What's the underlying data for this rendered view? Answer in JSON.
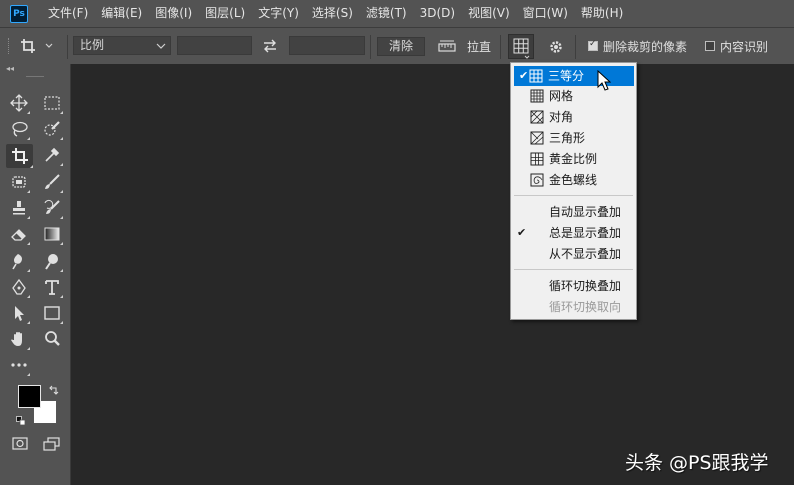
{
  "app": {
    "logo": "Ps"
  },
  "menu": [
    "文件(F)",
    "编辑(E)",
    "图像(I)",
    "图层(L)",
    "文字(Y)",
    "选择(S)",
    "滤镜(T)",
    "3D(D)",
    "视图(V)",
    "窗口(W)",
    "帮助(H)"
  ],
  "options": {
    "ratio_select": "比例",
    "clear_label": "清除",
    "straighten_label": "拉直",
    "delete_cropped_label": "删除裁剪的像素",
    "delete_cropped_checked": true,
    "content_aware_label": "内容识别",
    "content_aware_checked": false
  },
  "overlay_menu": {
    "overlay_items": [
      {
        "label": "三等分",
        "checked": true,
        "highlighted": true,
        "icon": "rule-of-thirds-icon"
      },
      {
        "label": "网格",
        "checked": false,
        "icon": "grid-icon"
      },
      {
        "label": "对角",
        "checked": false,
        "icon": "diagonal-icon"
      },
      {
        "label": "三角形",
        "checked": false,
        "icon": "triangle-icon"
      },
      {
        "label": "黄金比例",
        "checked": false,
        "icon": "golden-ratio-icon"
      },
      {
        "label": "金色螺线",
        "checked": false,
        "icon": "golden-spiral-icon"
      }
    ],
    "display_items": [
      {
        "label": "自动显示叠加",
        "checked": false
      },
      {
        "label": "总是显示叠加",
        "checked": true
      },
      {
        "label": "从不显示叠加",
        "checked": false
      }
    ],
    "cycle_items": [
      {
        "label": "循环切换叠加",
        "enabled": true
      },
      {
        "label": "循环切换取向",
        "enabled": false
      }
    ]
  },
  "colors": {
    "foreground": "#000000",
    "background": "#ffffff",
    "highlight": "#0078d7"
  },
  "watermark": "头条 @PS跟我学"
}
